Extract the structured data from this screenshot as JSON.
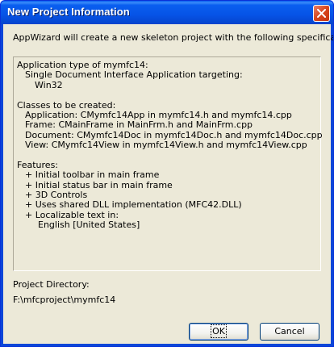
{
  "window": {
    "title": "New Project Information"
  },
  "intro_text": "AppWizard will create a new skeleton project with the following specifications:",
  "info_lines": [
    {
      "text": "Application type of mymfc14:",
      "indent": 0
    },
    {
      "text": "Single Document Interface Application targeting:",
      "indent": 1
    },
    {
      "text": "Win32",
      "indent": 2
    },
    {
      "text": "",
      "indent": 0
    },
    {
      "text": "Classes to be created:",
      "indent": 0
    },
    {
      "text": "Application: CMymfc14App in mymfc14.h and mymfc14.cpp",
      "indent": 1
    },
    {
      "text": "Frame: CMainFrame in MainFrm.h and MainFrm.cpp",
      "indent": 1
    },
    {
      "text": "Document: CMymfc14Doc in mymfc14Doc.h and mymfc14Doc.cpp",
      "indent": 1
    },
    {
      "text": "View: CMymfc14View in mymfc14View.h and mymfc14View.cpp",
      "indent": 1
    },
    {
      "text": "",
      "indent": 0
    },
    {
      "text": "Features:",
      "indent": 0
    },
    {
      "text": "+ Initial toolbar in main frame",
      "indent": 1
    },
    {
      "text": "+ Initial status bar in main frame",
      "indent": 1
    },
    {
      "text": "+ 3D Controls",
      "indent": 1
    },
    {
      "text": "+ Uses shared DLL implementation (MFC42.DLL)",
      "indent": 1
    },
    {
      "text": "+ Localizable text in:",
      "indent": 1
    },
    {
      "text": "English [United States]",
      "indent": 3
    }
  ],
  "project_directory": {
    "label": "Project Directory:",
    "path": "F:\\mfcproject\\mymfc14"
  },
  "buttons": {
    "ok": "OK",
    "cancel": "Cancel"
  },
  "icons": {
    "close": "close-icon"
  },
  "colors": {
    "titlebar": "#0a5ff0",
    "close_button": "#d8461c",
    "dialog_bg": "#ece9d8"
  }
}
